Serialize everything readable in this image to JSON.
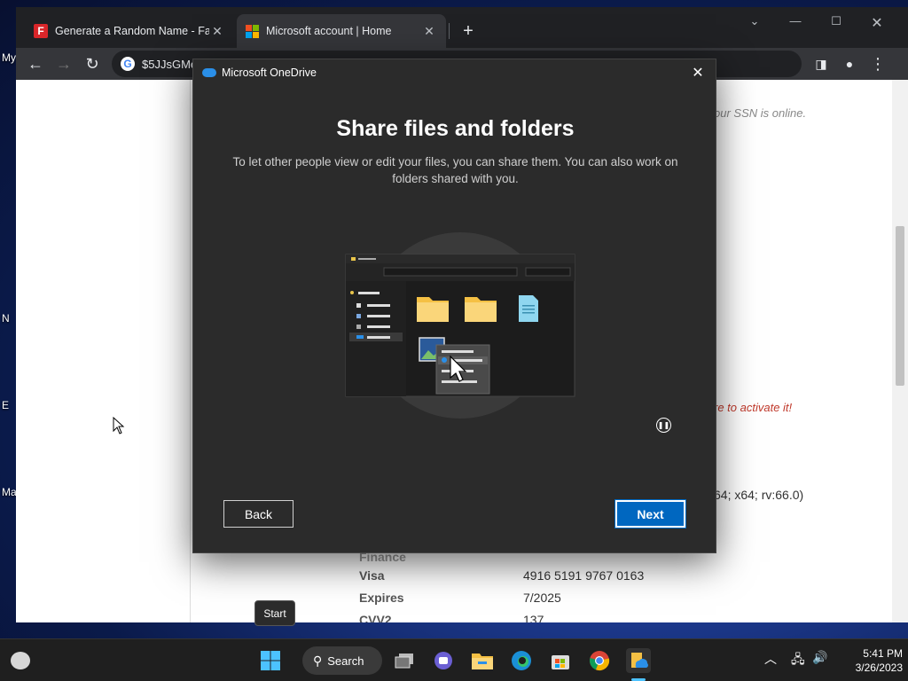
{
  "browser": {
    "tabs": [
      {
        "title": "Generate a Random Name - Fake",
        "icon": "fakename-favicon"
      },
      {
        "title": "Microsoft account | Home",
        "icon": "microsoft-logo"
      }
    ],
    "address": "$5JJsGMe"
  },
  "desktop": {
    "labels": [
      "My",
      "N",
      "E",
      "Ma"
    ]
  },
  "page": {
    "ssn_note": "our SSN is online.",
    "activate_note": "re to activate it!",
    "useragent": "64; x64; rv:66.0)",
    "finance_heading": "Finance",
    "finance": [
      {
        "label": "Visa",
        "value": "4916 5191 9767 0163"
      },
      {
        "label": "Expires",
        "value": "7/2025"
      },
      {
        "label": "CVV2",
        "value": "137"
      }
    ]
  },
  "dialog": {
    "title": "Microsoft OneDrive",
    "headline": "Share files and folders",
    "subtitle": "To let other people view or edit your files, you can share them. You can also work on folders shared with you.",
    "back_label": "Back",
    "next_label": "Next"
  },
  "tooltip": "Start",
  "taskbar": {
    "search_label": "Search",
    "time": "5:41 PM",
    "date": "3/26/2023"
  },
  "colors": {
    "accent": "#0067c0",
    "onedrive_blue": "#2a8fe8",
    "dialog_bg": "#2b2b2b"
  }
}
